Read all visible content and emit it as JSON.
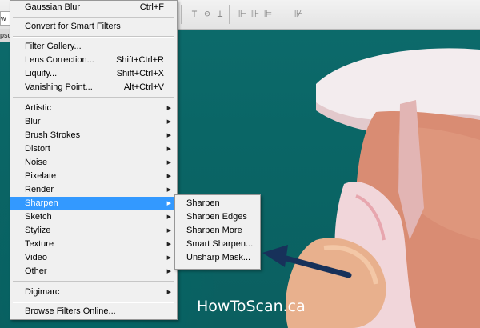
{
  "options_bar": {
    "tab_fragment": "w T",
    "doc_tab_fragment": "psd",
    "toolbar_icons": [
      "align-top-icon",
      "align-vcenter-icon",
      "align-bottom-icon",
      "distribute-left-icon",
      "distribute-hcenter-icon",
      "distribute-right-icon",
      "auto-align-icon"
    ]
  },
  "filter_menu": {
    "items": [
      {
        "label": "Gaussian Blur",
        "shortcut": "Ctrl+F"
      },
      {
        "label": "Convert for Smart Filters",
        "shortcut": ""
      },
      {
        "label": "Filter Gallery...",
        "shortcut": ""
      },
      {
        "label": "Lens Correction...",
        "shortcut": "Shift+Ctrl+R"
      },
      {
        "label": "Liquify...",
        "shortcut": "Shift+Ctrl+X"
      },
      {
        "label": "Vanishing Point...",
        "shortcut": "Alt+Ctrl+V"
      },
      {
        "label": "Artistic",
        "submenu": true
      },
      {
        "label": "Blur",
        "submenu": true
      },
      {
        "label": "Brush Strokes",
        "submenu": true
      },
      {
        "label": "Distort",
        "submenu": true
      },
      {
        "label": "Noise",
        "submenu": true
      },
      {
        "label": "Pixelate",
        "submenu": true
      },
      {
        "label": "Render",
        "submenu": true
      },
      {
        "label": "Sharpen",
        "submenu": true,
        "active": true
      },
      {
        "label": "Sketch",
        "submenu": true
      },
      {
        "label": "Stylize",
        "submenu": true
      },
      {
        "label": "Texture",
        "submenu": true
      },
      {
        "label": "Video",
        "submenu": true
      },
      {
        "label": "Other",
        "submenu": true
      },
      {
        "label": "Digimarc",
        "submenu": true
      },
      {
        "label": "Browse Filters Online...",
        "shortcut": ""
      }
    ],
    "highlight_color": "#3399ff"
  },
  "sharpen_submenu": {
    "items": [
      "Sharpen",
      "Sharpen Edges",
      "Sharpen More",
      "Smart Sharpen...",
      "Unsharp Mask..."
    ]
  },
  "watermark": "HowToScan.ca",
  "colors": {
    "canvas_teal": "#0a6666",
    "arrow_navy": "#17315a"
  }
}
